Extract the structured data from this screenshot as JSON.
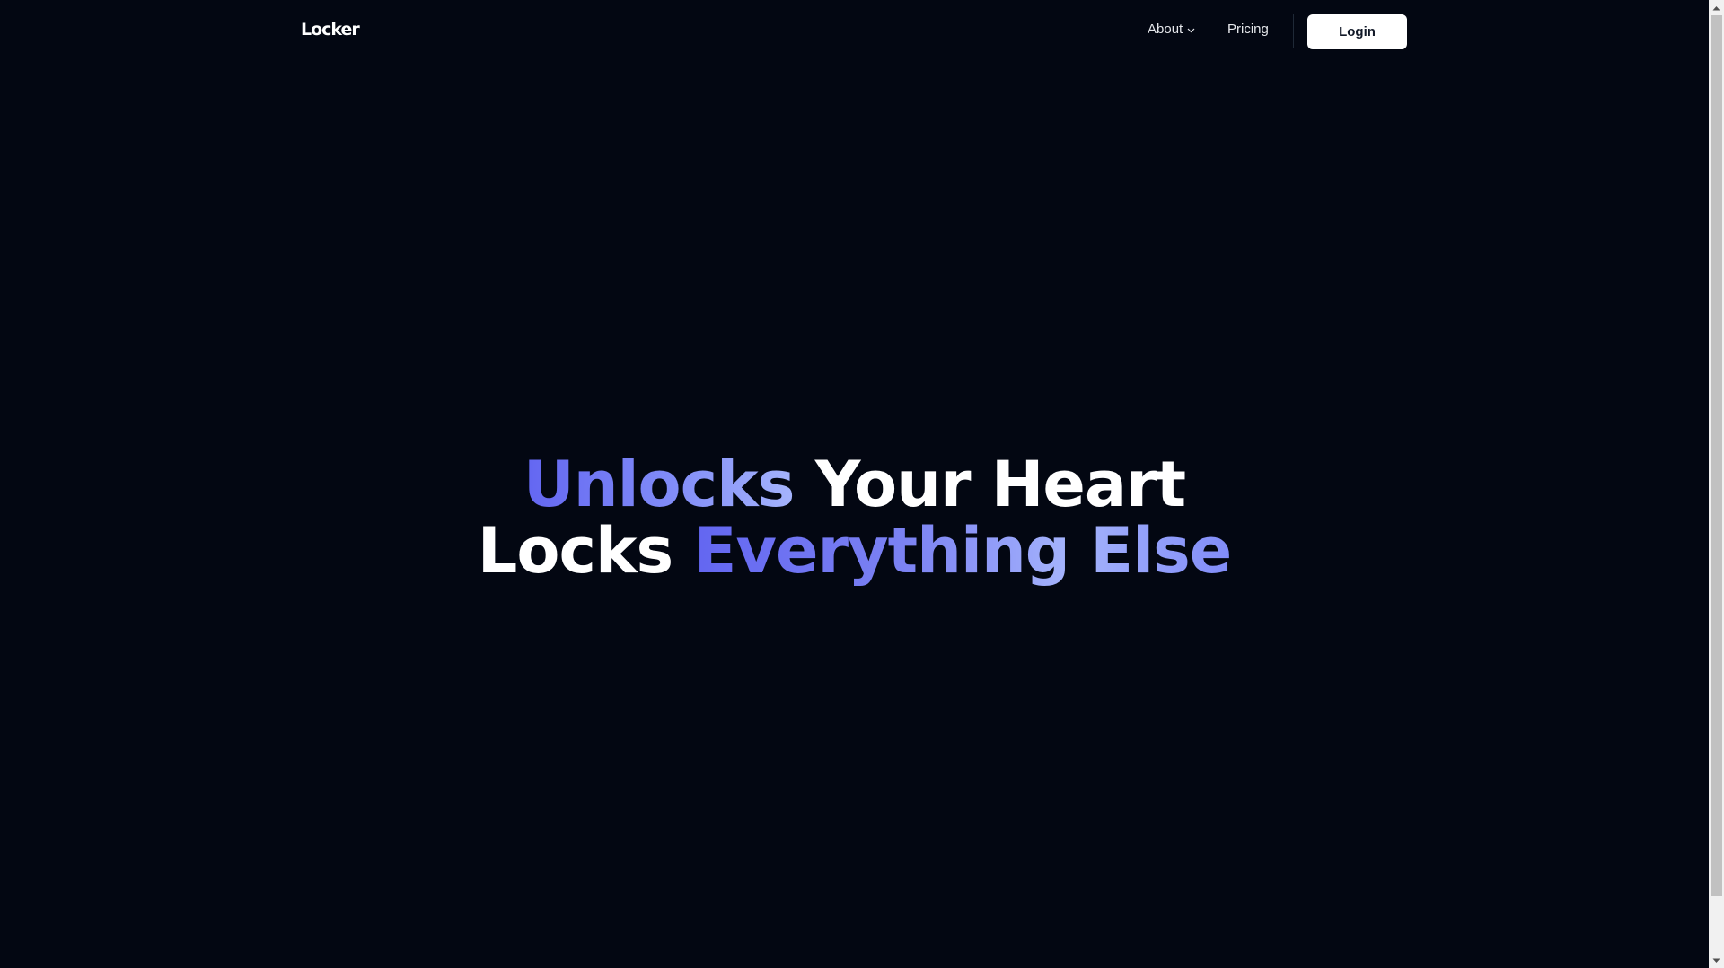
{
  "navbar": {
    "logo": "Locker",
    "about_label": "About",
    "pricing_label": "Pricing",
    "login_label": "Login"
  },
  "hero": {
    "line1_accent": "Unlocks",
    "line1_rest": "Your Heart",
    "line2_start": "Locks",
    "line2_accent": "Everything Else"
  },
  "colors": {
    "background": "#030712",
    "accent": "#6366f1",
    "accent_light": "#a5b4fc",
    "button_bg": "#ffffff"
  },
  "icons": {
    "about_dropdown": "chevron-down-icon",
    "scroll_up": "scroll-up-arrow-icon",
    "scroll_down": "scroll-down-arrow-icon"
  }
}
